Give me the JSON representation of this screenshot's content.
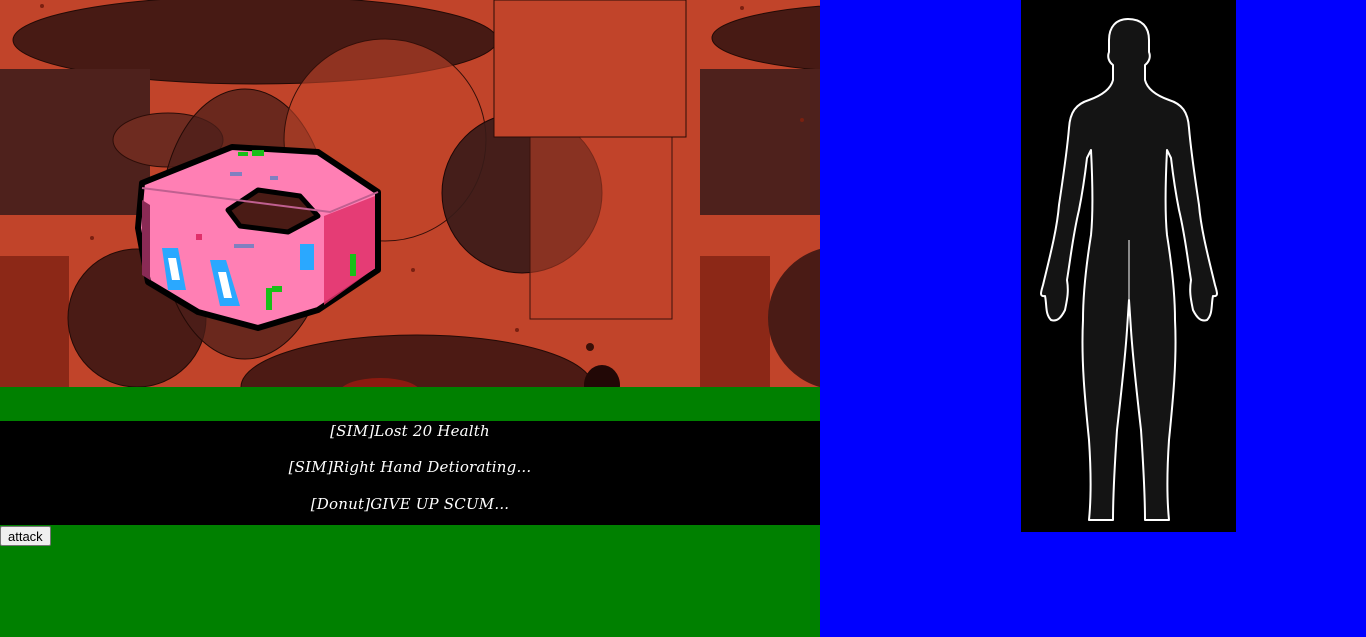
{
  "game": {
    "enemy": "Donut",
    "log": [
      "[SIM]Lost 20 Health",
      "[SIM]Right Hand Detiorating...",
      "[Donut]GIVE UP SCUM..."
    ],
    "actions": {
      "attack_label": "attack"
    }
  },
  "colors": {
    "background": "#c1442a",
    "ground": "#008000",
    "side_panel": "#0000ff",
    "donut_icing": "#ff7fb4",
    "log_bg": "#000000"
  }
}
